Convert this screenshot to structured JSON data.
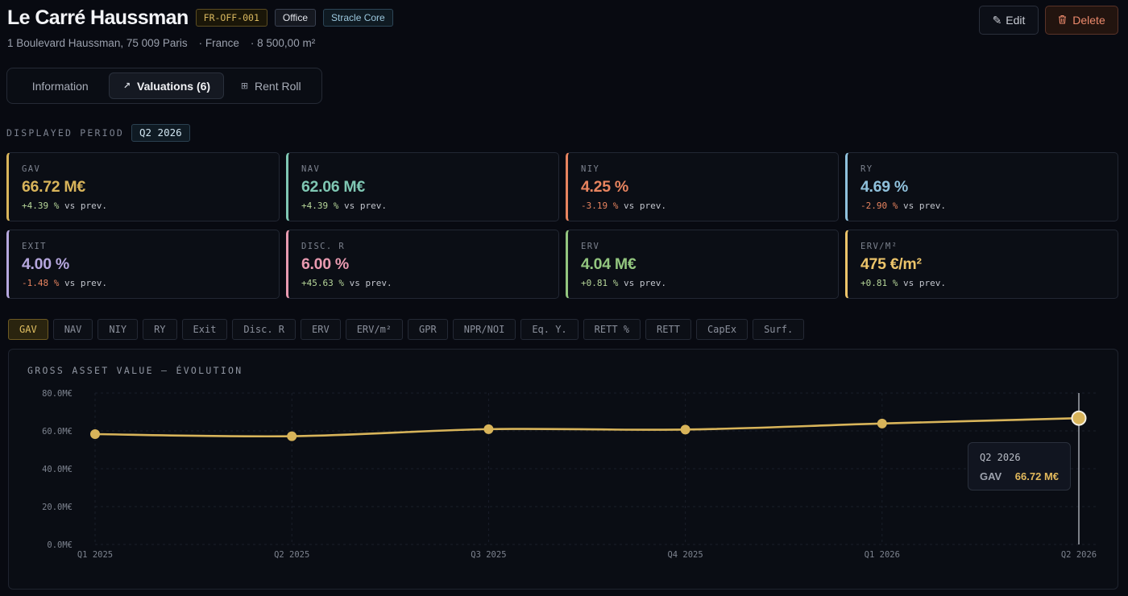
{
  "asset": {
    "name": "Le Carré Haussman",
    "code": "FR-OFF-001",
    "type": "Office",
    "fund": "Stracle Core",
    "address": "1 Boulevard Haussman, 75 009 Paris",
    "country": "· France",
    "surface": "· 8 500,00 m²"
  },
  "actions": {
    "edit_label": "Edit",
    "edit_icon": "pencil-icon",
    "delete_label": "Delete",
    "delete_icon": "trash-icon"
  },
  "tabs": [
    {
      "label": "Information",
      "icon": ""
    },
    {
      "label": "Valuations (6)",
      "icon": "trend-arrow-icon"
    },
    {
      "label": "Rent Roll",
      "icon": "grid-icon"
    }
  ],
  "period": {
    "label": "DISPLAYED PERIOD",
    "value": "Q2 2026"
  },
  "kpis": [
    {
      "label": "GAV",
      "value": "66.72 M€",
      "delta": "+4.39 %",
      "suffix": "vs prev.",
      "color": "#d8b45a",
      "delta_color": "#b7d79a"
    },
    {
      "label": "NAV",
      "value": "62.06 M€",
      "delta": "+4.39 %",
      "suffix": "vs prev.",
      "color": "#7fc7b3",
      "delta_color": "#b7d79a"
    },
    {
      "label": "NIY",
      "value": "4.25 %",
      "delta": "-3.19 %",
      "suffix": "vs prev.",
      "color": "#e8845f",
      "delta_color": "#e8845f"
    },
    {
      "label": "RY",
      "value": "4.69 %",
      "delta": "-2.90 %",
      "suffix": "vs prev.",
      "color": "#8fc1dc",
      "delta_color": "#e8845f"
    },
    {
      "label": "EXIT",
      "value": "4.00 %",
      "delta": "-1.48 %",
      "suffix": "vs prev.",
      "color": "#b6a7de",
      "delta_color": "#e8845f"
    },
    {
      "label": "DISC. R",
      "value": "6.00 %",
      "delta": "+45.63 %",
      "suffix": "vs prev.",
      "color": "#e99ab0",
      "delta_color": "#b7d79a"
    },
    {
      "label": "ERV",
      "value": "4.04 M€",
      "delta": "+0.81 %",
      "suffix": "vs prev.",
      "color": "#93c67f",
      "delta_color": "#b7d79a"
    },
    {
      "label": "ERV/M²",
      "value": "475 €/m²",
      "delta": "+0.81 %",
      "suffix": "vs prev.",
      "color": "#ecc46a",
      "delta_color": "#b7d79a"
    }
  ],
  "metrics": [
    "GAV",
    "NAV",
    "NIY",
    "RY",
    "Exit",
    "Disc. R",
    "ERV",
    "ERV/m²",
    "GPR",
    "NPR/NOI",
    "Eq. Y.",
    "RETT %",
    "RETT",
    "CapEx",
    "Surf."
  ],
  "active_metric": "GAV",
  "tooltip": {
    "period": "Q2 2026",
    "label": "GAV",
    "value": "66.72 M€"
  },
  "chart_data": {
    "type": "line",
    "title": "GROSS ASSET VALUE — ÉVOLUTION",
    "x": [
      "Q1 2025",
      "Q2 2025",
      "Q3 2025",
      "Q4 2025",
      "Q1 2026",
      "Q2 2026"
    ],
    "series": [
      {
        "name": "GAV",
        "values": [
          58.3,
          57.2,
          60.9,
          60.7,
          63.9,
          66.72
        ]
      }
    ],
    "ylim": [
      0,
      80
    ],
    "yticks": [
      "0.0M€",
      "20.0M€",
      "40.0M€",
      "60.0M€",
      "80.0M€"
    ],
    "ytick_values": [
      0,
      20,
      40,
      60,
      80
    ],
    "grid": true,
    "color": "#d8b45a",
    "highlight_index": 5
  }
}
